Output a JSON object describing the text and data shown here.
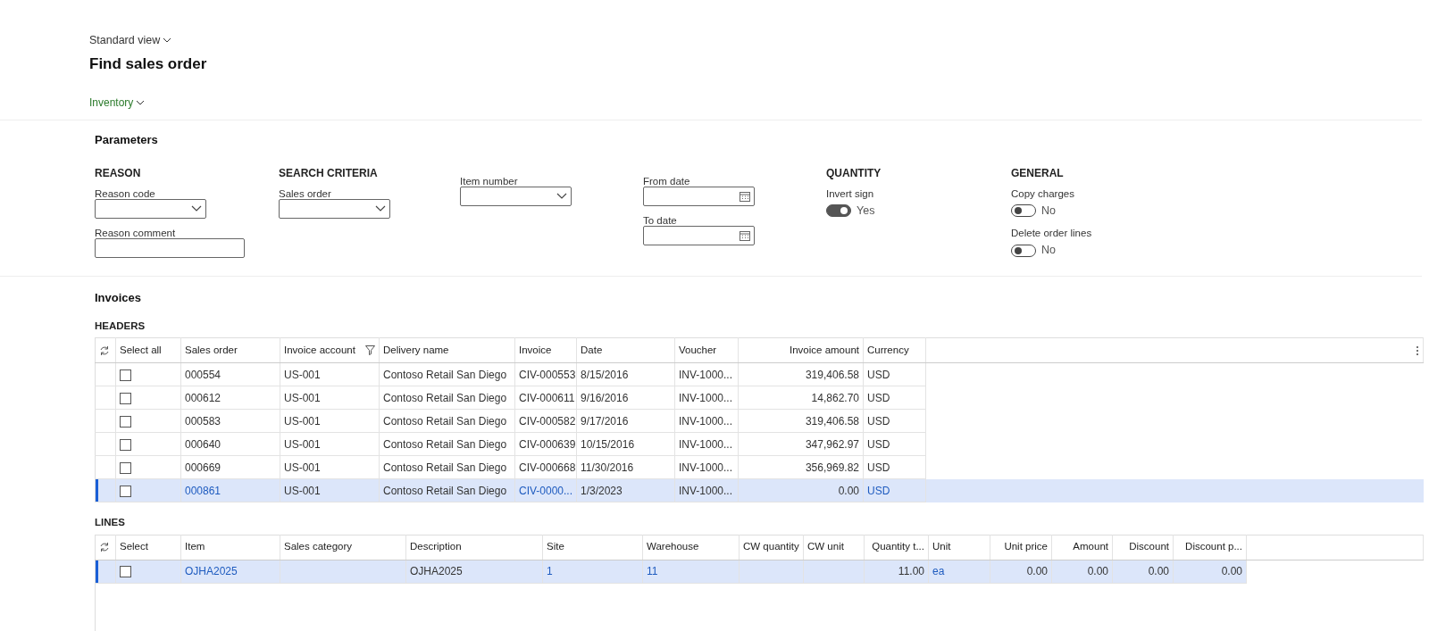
{
  "view_selector": "Standard view",
  "title": "Find sales order",
  "module_menu": "Inventory",
  "parameters": {
    "title": "Parameters",
    "groups": [
      {
        "heading": "REASON",
        "fields": [
          {
            "kind": "dropdown",
            "label": "Reason code"
          },
          {
            "kind": "text",
            "label": "Reason comment"
          }
        ]
      },
      {
        "heading": "SEARCH CRITERIA",
        "fields": [
          {
            "kind": "dropdown",
            "label": "Sales order"
          }
        ]
      },
      {
        "fields": [
          {
            "kind": "dropdown",
            "label": "Item number"
          }
        ]
      },
      {
        "fields": [
          {
            "kind": "date",
            "label": "From date"
          },
          {
            "kind": "date",
            "label": "To date"
          }
        ]
      },
      {
        "heading": "QUANTITY",
        "fields": [
          {
            "kind": "toggle",
            "label": "Invert sign",
            "on": true,
            "value": "Yes"
          }
        ]
      },
      {
        "heading": "GENERAL",
        "fields": [
          {
            "kind": "toggle",
            "label": "Copy charges",
            "on": false,
            "value": "No"
          },
          {
            "kind": "toggle",
            "label": "Delete order lines",
            "on": false,
            "value": "No"
          }
        ]
      }
    ]
  },
  "invoices": {
    "title": "Invoices",
    "headers": {
      "title": "HEADERS",
      "select_label": "Select all",
      "more_menu": true,
      "columns": [
        {
          "label": "Sales order"
        },
        {
          "label": "Invoice account",
          "filtered": true
        },
        {
          "label": "Delivery name"
        },
        {
          "label": "Invoice"
        },
        {
          "label": "Date"
        },
        {
          "label": "Voucher"
        },
        {
          "label": "Invoice amount",
          "numeric": true
        },
        {
          "label": "Currency"
        }
      ],
      "rows": [
        {
          "selected": false,
          "checked": false,
          "cells": [
            "000554",
            "US-001",
            "Contoso Retail San Diego",
            "CIV-000553",
            "8/15/2016",
            "INV-1000...",
            "319,406.58",
            "USD"
          ]
        },
        {
          "selected": false,
          "checked": false,
          "cells": [
            "000612",
            "US-001",
            "Contoso Retail San Diego",
            "CIV-000611",
            "9/16/2016",
            "INV-1000...",
            "14,862.70",
            "USD"
          ]
        },
        {
          "selected": false,
          "checked": false,
          "cells": [
            "000583",
            "US-001",
            "Contoso Retail San Diego",
            "CIV-000582",
            "9/17/2016",
            "INV-1000...",
            "319,406.58",
            "USD"
          ]
        },
        {
          "selected": false,
          "checked": false,
          "cells": [
            "000640",
            "US-001",
            "Contoso Retail San Diego",
            "CIV-000639",
            "10/15/2016",
            "INV-1000...",
            "347,962.97",
            "USD"
          ]
        },
        {
          "selected": false,
          "checked": false,
          "cells": [
            "000669",
            "US-001",
            "Contoso Retail San Diego",
            "CIV-000668",
            "11/30/2016",
            "INV-1000...",
            "356,969.82",
            "USD"
          ]
        },
        {
          "selected": true,
          "checked": false,
          "cells": [
            {
              "text": "000861",
              "link": true
            },
            "US-001",
            "Contoso Retail San Diego",
            {
              "text": "CIV-0000...",
              "link": true
            },
            "1/3/2023",
            "INV-1000...",
            "0.00",
            {
              "text": "USD",
              "link": true
            }
          ]
        }
      ]
    },
    "lines": {
      "title": "LINES",
      "select_label": "Select",
      "more_menu": false,
      "columns": [
        {
          "label": "Item"
        },
        {
          "label": "Sales category"
        },
        {
          "label": "Description"
        },
        {
          "label": "Site"
        },
        {
          "label": "Warehouse"
        },
        {
          "label": "CW quantity"
        },
        {
          "label": "CW unit"
        },
        {
          "label": "Quantity t...",
          "numeric": true
        },
        {
          "label": "Unit"
        },
        {
          "label": "Unit price",
          "numeric": true
        },
        {
          "label": "Amount",
          "numeric": true
        },
        {
          "label": "Discount",
          "numeric": true
        },
        {
          "label": "Discount p...",
          "numeric": true
        }
      ],
      "rows": [
        {
          "selected": true,
          "checked": false,
          "cells": [
            {
              "text": "OJHA2025",
              "link": true
            },
            "",
            "OJHA2025",
            {
              "text": "1",
              "link": true
            },
            {
              "text": "11",
              "link": true
            },
            "",
            "",
            "11.00",
            {
              "text": "ea",
              "link": true
            },
            "0.00",
            "0.00",
            "0.00",
            "0.00"
          ]
        }
      ]
    }
  }
}
